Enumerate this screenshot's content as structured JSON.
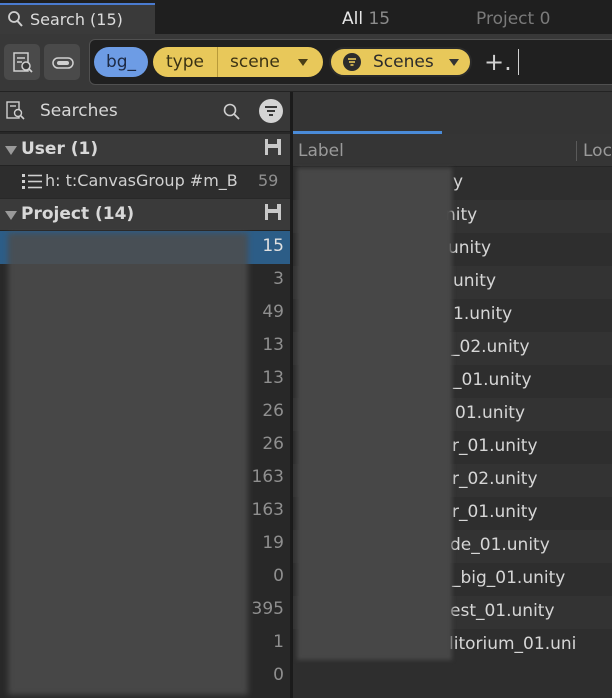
{
  "window": {
    "tab_title": "Search (15)"
  },
  "toolbar": {
    "query_chips": [
      {
        "text": "bg_",
        "color": "#6d9ce5"
      },
      {
        "key": "type",
        "value": "scene",
        "color": "#e8c85a"
      },
      {
        "value": "Scenes",
        "color": "#e8c85a"
      }
    ],
    "add_label": "+."
  },
  "searches_panel": {
    "title": "Searches",
    "groups": {
      "user": {
        "label": "User (1)",
        "items": [
          {
            "label": "h: t:CanvasGroup #m_B",
            "count": "59"
          }
        ]
      },
      "project": {
        "label": "Project (14)",
        "counts": [
          "15",
          "3",
          "49",
          "13",
          "13",
          "26",
          "26",
          "163",
          "163",
          "19",
          "0",
          "395",
          "1",
          "0"
        ]
      }
    }
  },
  "results": {
    "tabs": [
      {
        "label": "All",
        "count": "15"
      },
      {
        "label": "Project",
        "count": "0"
      }
    ],
    "columns": [
      "Label",
      "Loc"
    ],
    "rows": [
      "y",
      "nity",
      "unity",
      "unity",
      "1.unity",
      "_02.unity",
      "_01.unity",
      "01.unity",
      "r_01.unity",
      "r_02.unity",
      "r_01.unity",
      "de_01.unity",
      "_big_01.unity",
      "est_01.unity",
      "litorium_01.uni"
    ]
  }
}
